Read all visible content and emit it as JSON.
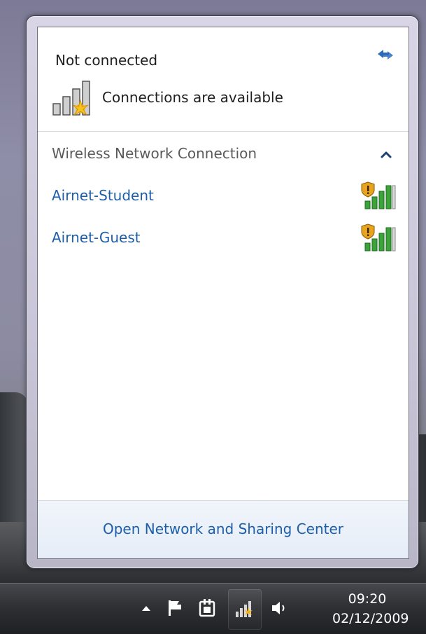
{
  "flyout": {
    "status_title": "Not connected",
    "status_text": "Connections are available",
    "section_header": "Wireless Network Connection",
    "networks": [
      {
        "name": "Airnet-Student",
        "signal_bars": 4,
        "secured": false
      },
      {
        "name": "Airnet-Guest",
        "signal_bars": 4,
        "secured": false
      }
    ],
    "footer_link": "Open Network and Sharing Center"
  },
  "taskbar": {
    "time": "09:20",
    "date": "02/12/2009",
    "tray_icons": [
      "show-hidden-icons",
      "action-center-flag-icon",
      "power-plug-icon",
      "network-icon",
      "volume-icon"
    ]
  },
  "colors": {
    "link": "#1d5ea9",
    "signal_green": "#3aa33a",
    "warning_shield": "#e0a020",
    "status_star": "#f2b21b"
  }
}
